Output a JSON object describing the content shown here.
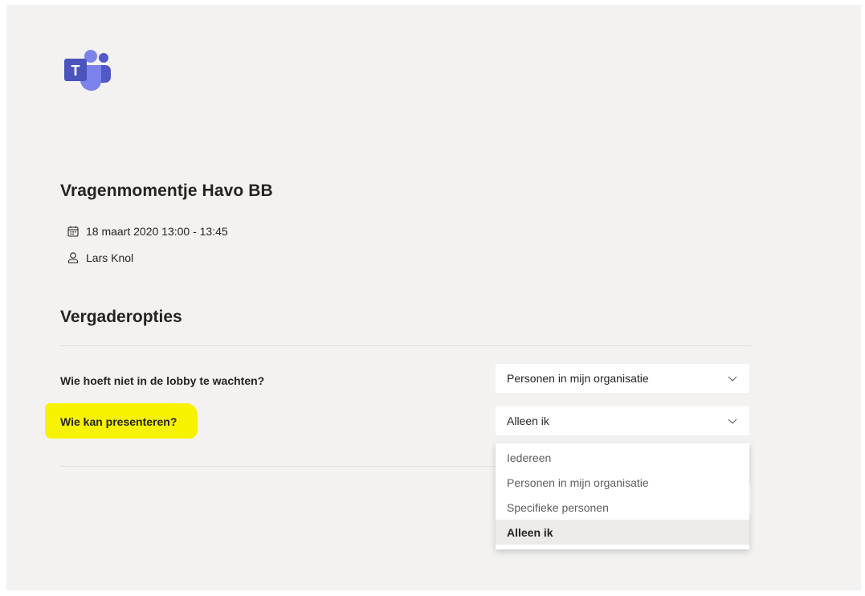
{
  "app": {
    "logo_icon": "microsoft-teams-logo",
    "brand_color": "#5059c9",
    "highlight_color": "#f6f200"
  },
  "meeting": {
    "title": "Vragenmomentje Havo BB",
    "datetime": "18 maart 2020 13:00 - 13:45",
    "datetime_icon": "calendar-icon",
    "organizer": "Lars Knol",
    "organizer_icon": "person-icon"
  },
  "options": {
    "section_title": "Vergaderopties",
    "lobby": {
      "label": "Wie hoeft niet in de lobby te wachten?",
      "value": "Personen in mijn organisatie"
    },
    "presenters": {
      "label": "Wie kan presenteren?",
      "value": "Alleen ik",
      "dropdown_open": true,
      "choices": [
        {
          "label": "Iedereen",
          "selected": false
        },
        {
          "label": "Personen in mijn organisatie",
          "selected": false
        },
        {
          "label": "Specifieke personen",
          "selected": false
        },
        {
          "label": "Alleen ik",
          "selected": true
        }
      ]
    }
  }
}
